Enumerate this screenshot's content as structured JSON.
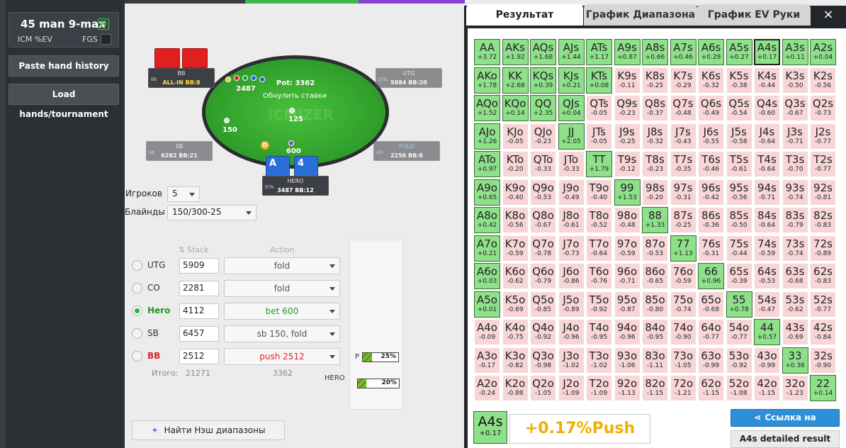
{
  "sidebar": {
    "game_title": "45 man 9-max",
    "badge": "N",
    "icm_label": "ICM %EV",
    "fgs_label": "FGS",
    "paste_button": "Paste hand history",
    "load_button": "Load hands/tournament"
  },
  "table": {
    "pot": "Pot: 3362",
    "reset": "Обнулить ставки",
    "watermark": "ICMIZER",
    "bets": {
      "bb": "2487",
      "utg": "125",
      "sb": "150",
      "hero": "600"
    },
    "dealer_label": "D",
    "hero_cards": [
      "A",
      "4"
    ],
    "seats": {
      "bb": {
        "pos": "BB",
        "name": "BB",
        "stack": "ALL-IN BB:8"
      },
      "utg": {
        "pos": "UTG",
        "name": "UTG",
        "stack": "5884 BB:20"
      },
      "sb": {
        "pos": "SB",
        "name": "SB",
        "stack": "6282 BB:21"
      },
      "co": {
        "pos": "CO",
        "name": "FOLD",
        "stack": "2256 BB:8"
      },
      "hero": {
        "pos": "BTN",
        "name": "HERO",
        "stack": "3487 BB:12"
      }
    }
  },
  "settings": {
    "players_label": "Игроков",
    "players_value": "5",
    "blinds_label": "Блайнды",
    "blinds_value": "150/300-25"
  },
  "players_table": {
    "stack_header": "Stack",
    "action_header": "Action",
    "rows": [
      {
        "name": "UTG",
        "stack": "5909",
        "action": "fold",
        "color": "#555555"
      },
      {
        "name": "CO",
        "stack": "2281",
        "action": "fold",
        "color": "#555555"
      },
      {
        "name": "Hero",
        "stack": "4112",
        "action": "bet 600",
        "color": "#1f9a1f"
      },
      {
        "name": "SB",
        "stack": "6457",
        "action": "sb 150, fold",
        "color": "#555555"
      },
      {
        "name": "BB",
        "stack": "2512",
        "action": "push 2512",
        "color": "#e02424"
      }
    ],
    "total_label": "Итого:",
    "total_stack": "21271",
    "total_action": "3362"
  },
  "stats": {
    "p_label": "P",
    "p_value": "25%",
    "p_fraction": 0.25,
    "hero_label": "HERO",
    "hero_value": "20%",
    "hero_fraction": 0.2
  },
  "nash_button": "Найти Нэш диапазоны",
  "panel": {
    "tabs": [
      "Результат",
      "График Диапазона",
      "График EV Руки"
    ],
    "close": "×",
    "selected": {
      "hand": "A4s",
      "ev": "+0.17",
      "result": "+0.17%Push"
    },
    "link_button": "Ссылка на результа",
    "detail_button": "A4s detailed result"
  },
  "ranks": [
    "A",
    "K",
    "Q",
    "J",
    "T",
    "9",
    "8",
    "7",
    "6",
    "5",
    "4",
    "3",
    "2"
  ],
  "grid": [
    [
      "+3.72",
      "+1.92",
      "+1.68",
      "+1.44",
      "+1.17",
      "+0.87",
      "+0.66",
      "+0.46",
      "+0.29",
      "+0.27",
      "+0.17",
      "+0.11",
      "+0.04"
    ],
    [
      "+1.78",
      "+2.68",
      "+0.39",
      "+0.21",
      "+0.08",
      "-0.11",
      "-0.25",
      "-0.29",
      "-0.32",
      "-0.38",
      "-0.44",
      "-0.50",
      "-0.56"
    ],
    [
      "+1.52",
      "+0.14",
      "+2.35",
      "+0.04",
      "-0.05",
      "-0.23",
      "-0.37",
      "-0.48",
      "-0.49",
      "-0.54",
      "-0.60",
      "-0.67",
      "-0.73"
    ],
    [
      "+1.26",
      "-0.05",
      "-0.23",
      "+2.05",
      "-0.05",
      "-0.25",
      "-0.32",
      "-0.43",
      "-0.55",
      "-0.58",
      "-0.64",
      "-0.71",
      "-0.77"
    ],
    [
      "+0.97",
      "-0.20",
      "-0.33",
      "-0.33",
      "+1.79",
      "-0.12",
      "-0.23",
      "-0.35",
      "-0.46",
      "-0.61",
      "-0.64",
      "-0.70",
      "-0.77"
    ],
    [
      "+0.65",
      "-0.40",
      "-0.53",
      "-0.49",
      "-0.40",
      "+1.53",
      "-0.20",
      "-0.31",
      "-0.42",
      "-0.56",
      "-0.71",
      "-0.74",
      "-0.81"
    ],
    [
      "+0.42",
      "-0.56",
      "-0.67",
      "-0.61",
      "-0.52",
      "-0.48",
      "+1.33",
      "-0.25",
      "-0.36",
      "-0.50",
      "-0.64",
      "-0.79",
      "-0.83"
    ],
    [
      "+0.21",
      "-0.59",
      "-0.78",
      "-0.73",
      "-0.64",
      "-0.59",
      "-0.53",
      "+1.13",
      "-0.31",
      "-0.44",
      "-0.59",
      "-0.74",
      "-0.89"
    ],
    [
      "+0.03",
      "-0.62",
      "-0.79",
      "-0.86",
      "-0.76",
      "-0.71",
      "-0.65",
      "-0.59",
      "+0.96",
      "-0.39",
      "-0.53",
      "-0.68",
      "-0.83"
    ],
    [
      "+0.01",
      "-0.69",
      "-0.85",
      "-0.89",
      "-0.92",
      "-0.87",
      "-0.80",
      "-0.74",
      "-0.68",
      "+0.78",
      "-0.47",
      "-0.62",
      "-0.77"
    ],
    [
      "-0.09",
      "-0.75",
      "-0.92",
      "-0.96",
      "-0.95",
      "-0.96",
      "-0.95",
      "-0.90",
      "-0.77",
      "-0.77",
      "+0.57",
      "-0.69",
      "-0.84"
    ],
    [
      "-0.17",
      "-0.82",
      "-0.98",
      "-1.02",
      "-1.02",
      "-1.06",
      "-1.11",
      "-1.05",
      "-0.99",
      "-0.92",
      "-0.99",
      "+0.36",
      "-0.90"
    ],
    [
      "-0.24",
      "-0.88",
      "-1.05",
      "-1.09",
      "-1.09",
      "-1.13",
      "-1.15",
      "-1.21",
      "-1.15",
      "-1.08",
      "-1.15",
      "-1.23",
      "+0.14"
    ]
  ]
}
